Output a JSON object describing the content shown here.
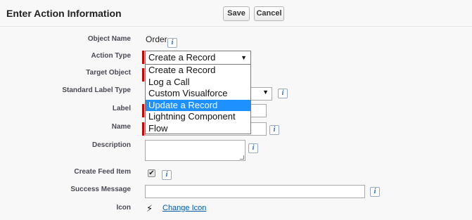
{
  "header": {
    "title": "Enter Action Information",
    "save_label": "Save",
    "cancel_label": "Cancel"
  },
  "form": {
    "object_name": {
      "label": "Object Name",
      "value": "Order"
    },
    "action_type": {
      "label": "Action Type",
      "selected": "Create a Record",
      "options": [
        "Create a Record",
        "Log a Call",
        "Custom Visualforce",
        "Update a Record",
        "Lightning Component",
        "Flow"
      ],
      "highlighted": "Update a Record"
    },
    "target_object": {
      "label": "Target Object"
    },
    "standard_label_type": {
      "label": "Standard Label Type"
    },
    "label_field": {
      "label": "Label"
    },
    "name_field": {
      "label": "Name"
    },
    "description": {
      "label": "Description"
    },
    "create_feed_item": {
      "label": "Create Feed Item",
      "checked": true,
      "check_glyph": "✔"
    },
    "success_message": {
      "label": "Success Message"
    },
    "icon": {
      "label": "Icon",
      "icon_glyph": "⚡",
      "change_label": "Change Icon"
    }
  },
  "info_glyph": "i",
  "colors": {
    "required": "#cc0000",
    "highlight": "#1e90ff",
    "link": "#015ba7"
  }
}
